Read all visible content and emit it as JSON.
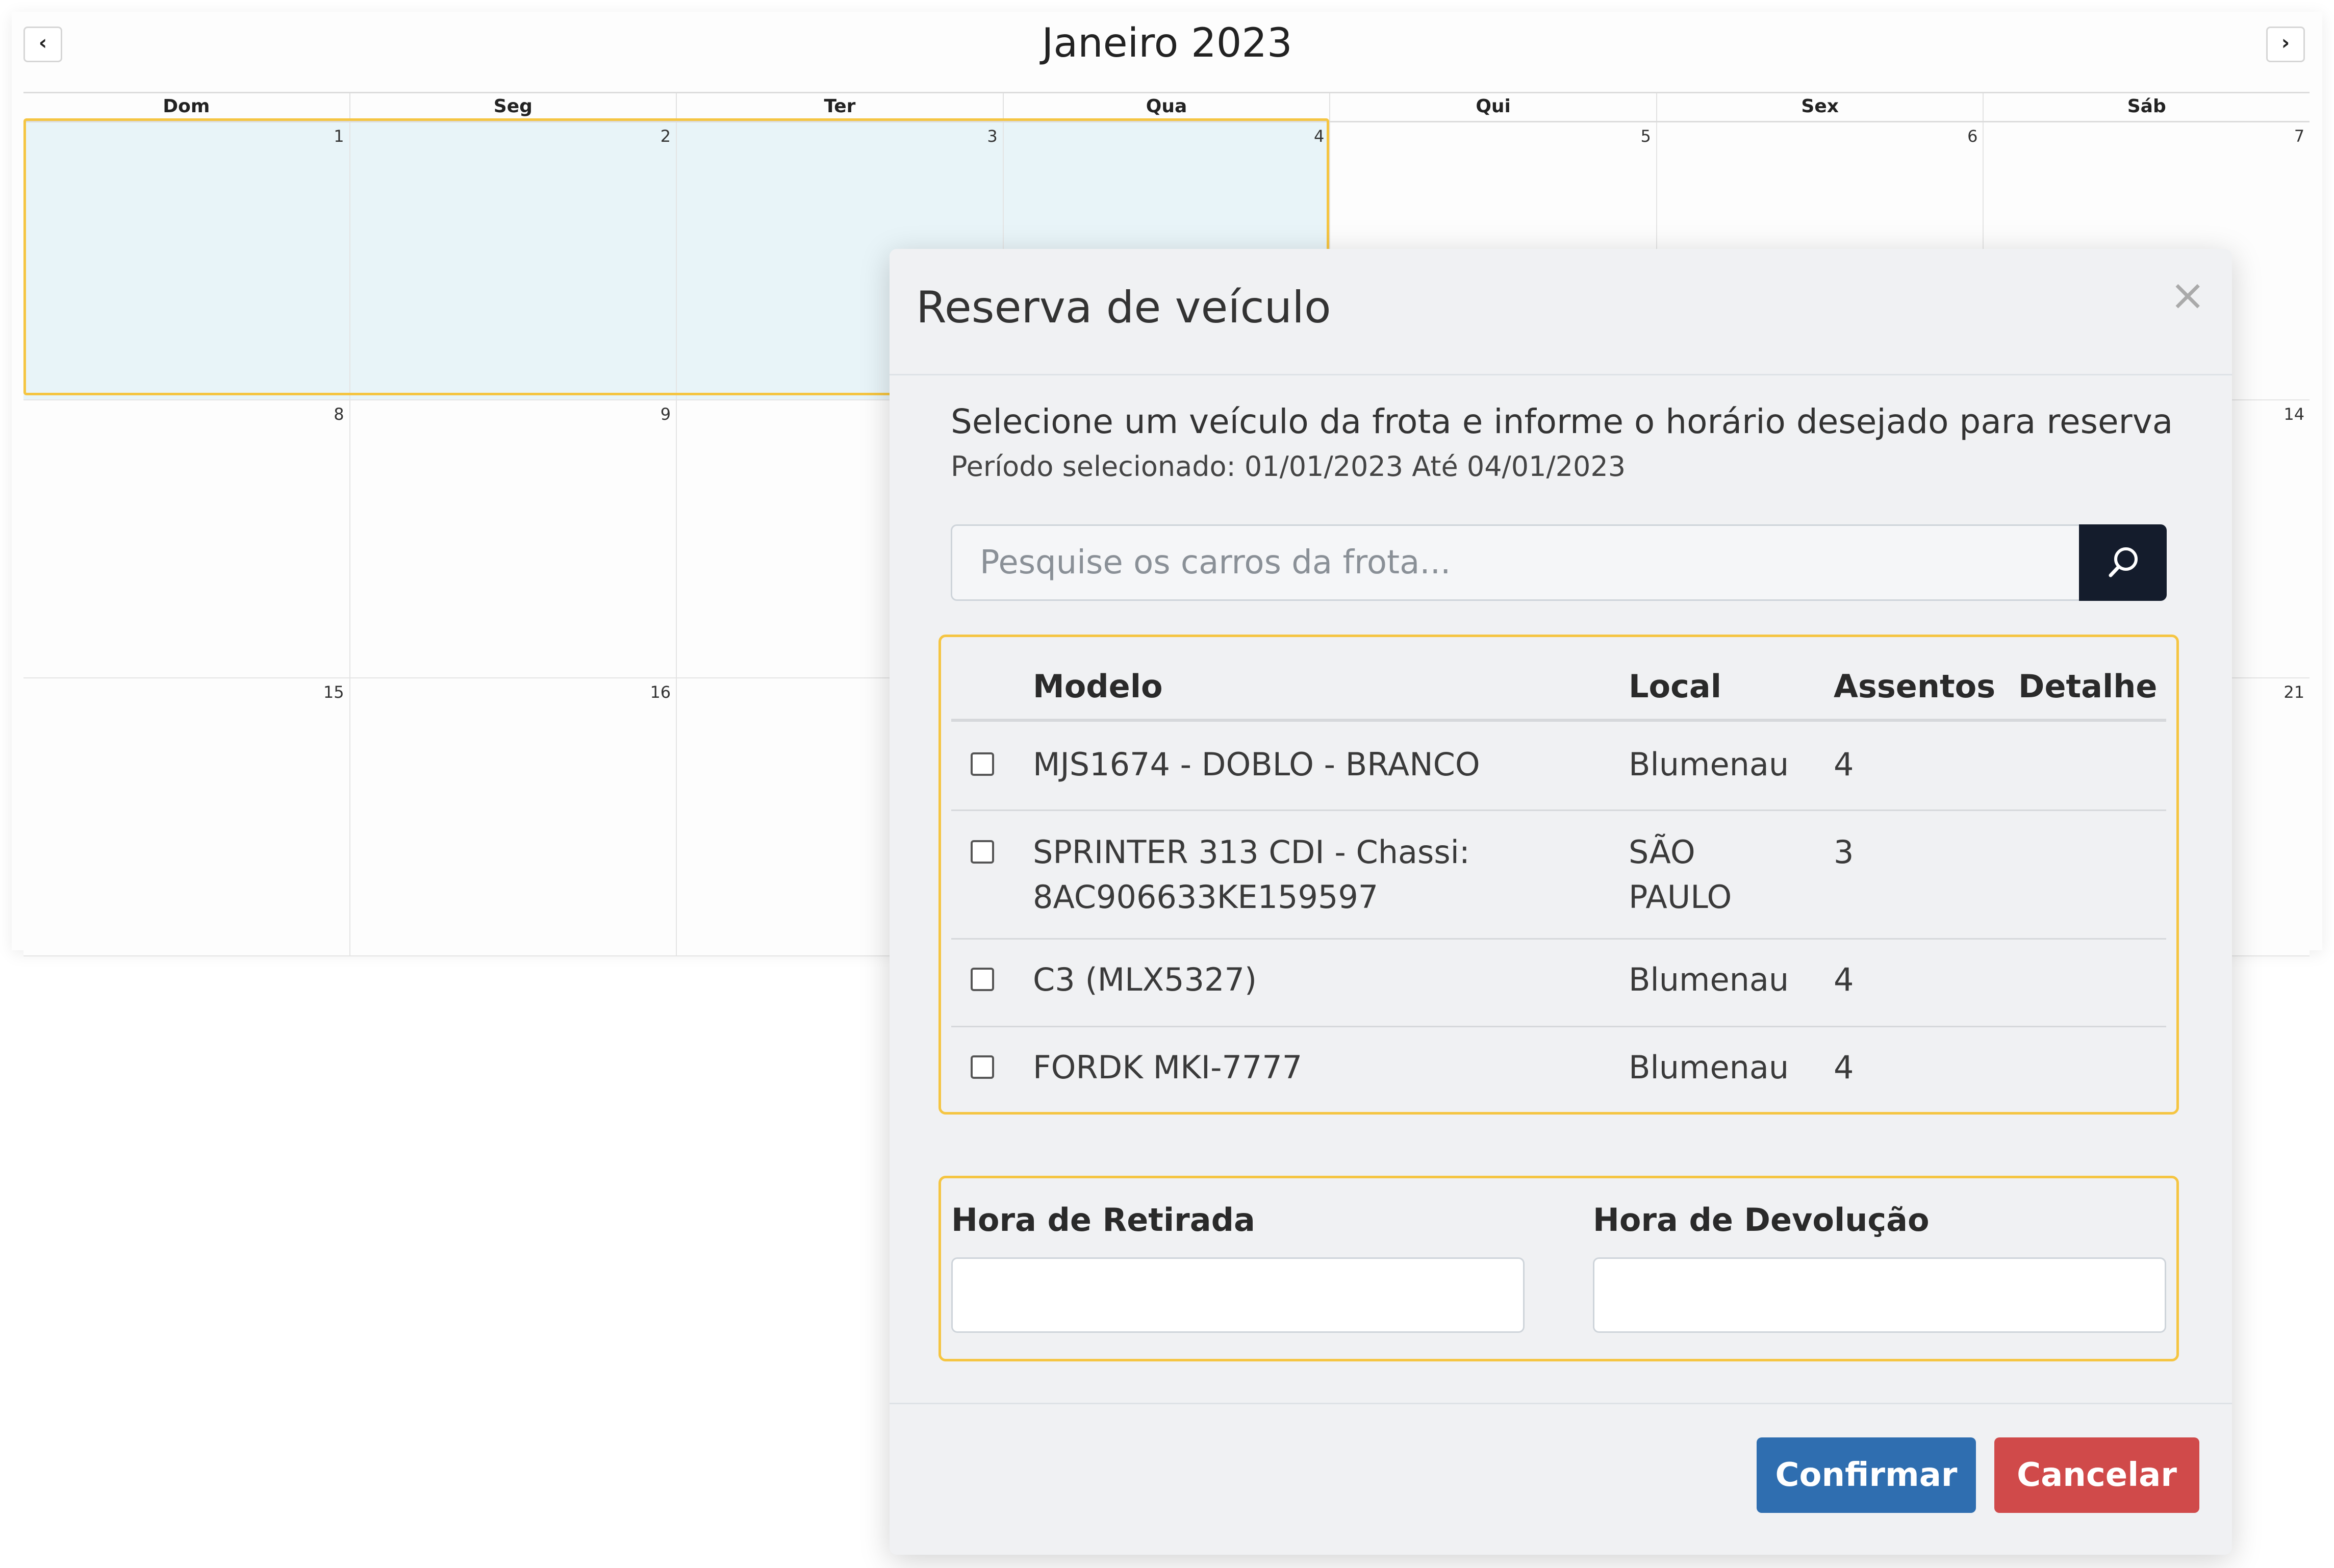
{
  "calendar": {
    "title": "Janeiro 2023",
    "prev_icon": "chevron-left-icon",
    "next_icon": "chevron-right-icon",
    "weekdays": [
      "Dom",
      "Seg",
      "Ter",
      "Qua",
      "Qui",
      "Sex",
      "Sáb"
    ],
    "weeks": [
      [
        "1",
        "2",
        "3",
        "4",
        "5",
        "6",
        "7"
      ],
      [
        "8",
        "9",
        "",
        "",
        "",
        "",
        "14"
      ],
      [
        "15",
        "16",
        "",
        "",
        "",
        "",
        "21"
      ]
    ],
    "selected_days": [
      "1",
      "2",
      "3",
      "4"
    ],
    "selection_color": "#e8f4f8",
    "selection_border": "#f5c542"
  },
  "modal": {
    "title": "Reserva de veículo",
    "close_icon": "close-icon",
    "intro": "Selecione um veículo da frota e informe o horário desejado para reserva",
    "period": "Período selecionado: 01/01/2023 Até 04/01/2023",
    "search": {
      "placeholder": "Pesquise os carros da frota...",
      "value": "",
      "button_icon": "search-icon"
    },
    "table": {
      "headers": {
        "modelo": "Modelo",
        "local": "Local",
        "assentos": "Assentos",
        "detalhe": "Detalhe"
      },
      "rows": [
        {
          "modelo": [
            "MJS1674 - DOBLO - BRANCO"
          ],
          "local": [
            "Blumenau"
          ],
          "assentos": "4",
          "checked": false
        },
        {
          "modelo": [
            "SPRINTER 313 CDI - Chassi:",
            "8AC906633KE159597"
          ],
          "local": [
            "SÃO",
            "PAULO"
          ],
          "assentos": "3",
          "checked": false
        },
        {
          "modelo": [
            "C3 (MLX5327)"
          ],
          "local": [
            "Blumenau"
          ],
          "assentos": "4",
          "checked": false
        },
        {
          "modelo": [
            "FORDK MKI-7777"
          ],
          "local": [
            "Blumenau"
          ],
          "assentos": "4",
          "checked": false
        }
      ]
    },
    "hours": {
      "pickup_label": "Hora de Retirada",
      "pickup_value": "",
      "return_label": "Hora de Devolução",
      "return_value": ""
    },
    "buttons": {
      "confirm": "Confirmar",
      "cancel": "Cancelar"
    },
    "colors": {
      "confirm": "#2f6eb0",
      "cancel": "#d04a4a",
      "search_button": "#141c2c",
      "highlight_border": "#f5c542"
    }
  }
}
